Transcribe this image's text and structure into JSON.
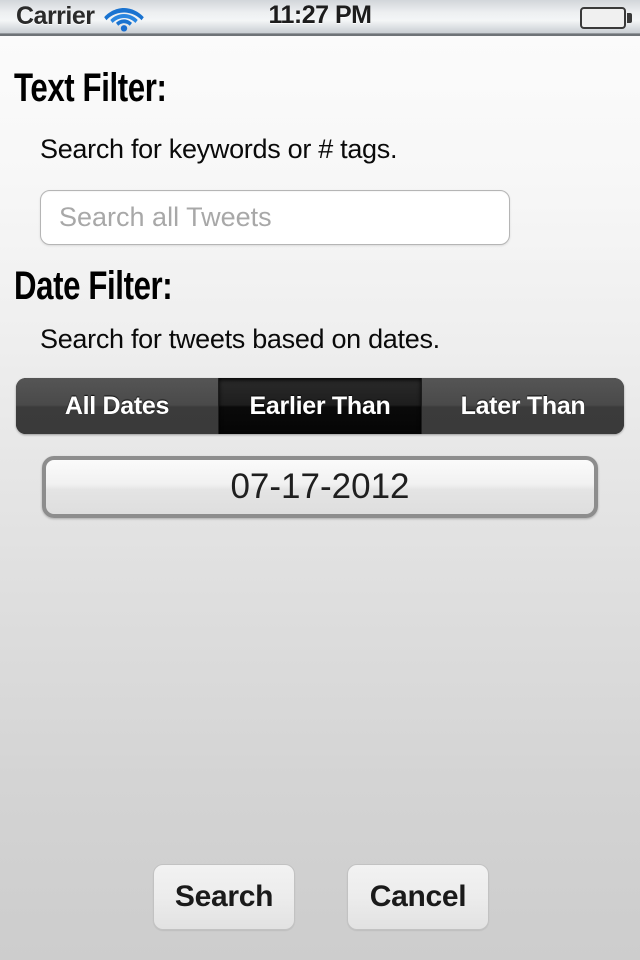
{
  "status_bar": {
    "carrier": "Carrier",
    "wifi_icon": "wifi-icon",
    "time": "11:27 PM",
    "battery_icon": "battery-icon",
    "battery_color": "#54c81b"
  },
  "text_filter": {
    "heading": "Text Filter:",
    "subtitle": "Search for keywords or # tags.",
    "search_placeholder": "Search all Tweets",
    "search_value": ""
  },
  "date_filter": {
    "heading": "Date Filter:",
    "subtitle": "Search for tweets based on dates.",
    "segments": [
      {
        "label": "All Dates",
        "selected": false
      },
      {
        "label": "Earlier Than",
        "selected": true
      },
      {
        "label": "Later Than",
        "selected": false
      }
    ],
    "selected_segment": "Earlier Than",
    "date_value": "07-17-2012"
  },
  "actions": {
    "search_label": "Search",
    "cancel_label": "Cancel"
  }
}
